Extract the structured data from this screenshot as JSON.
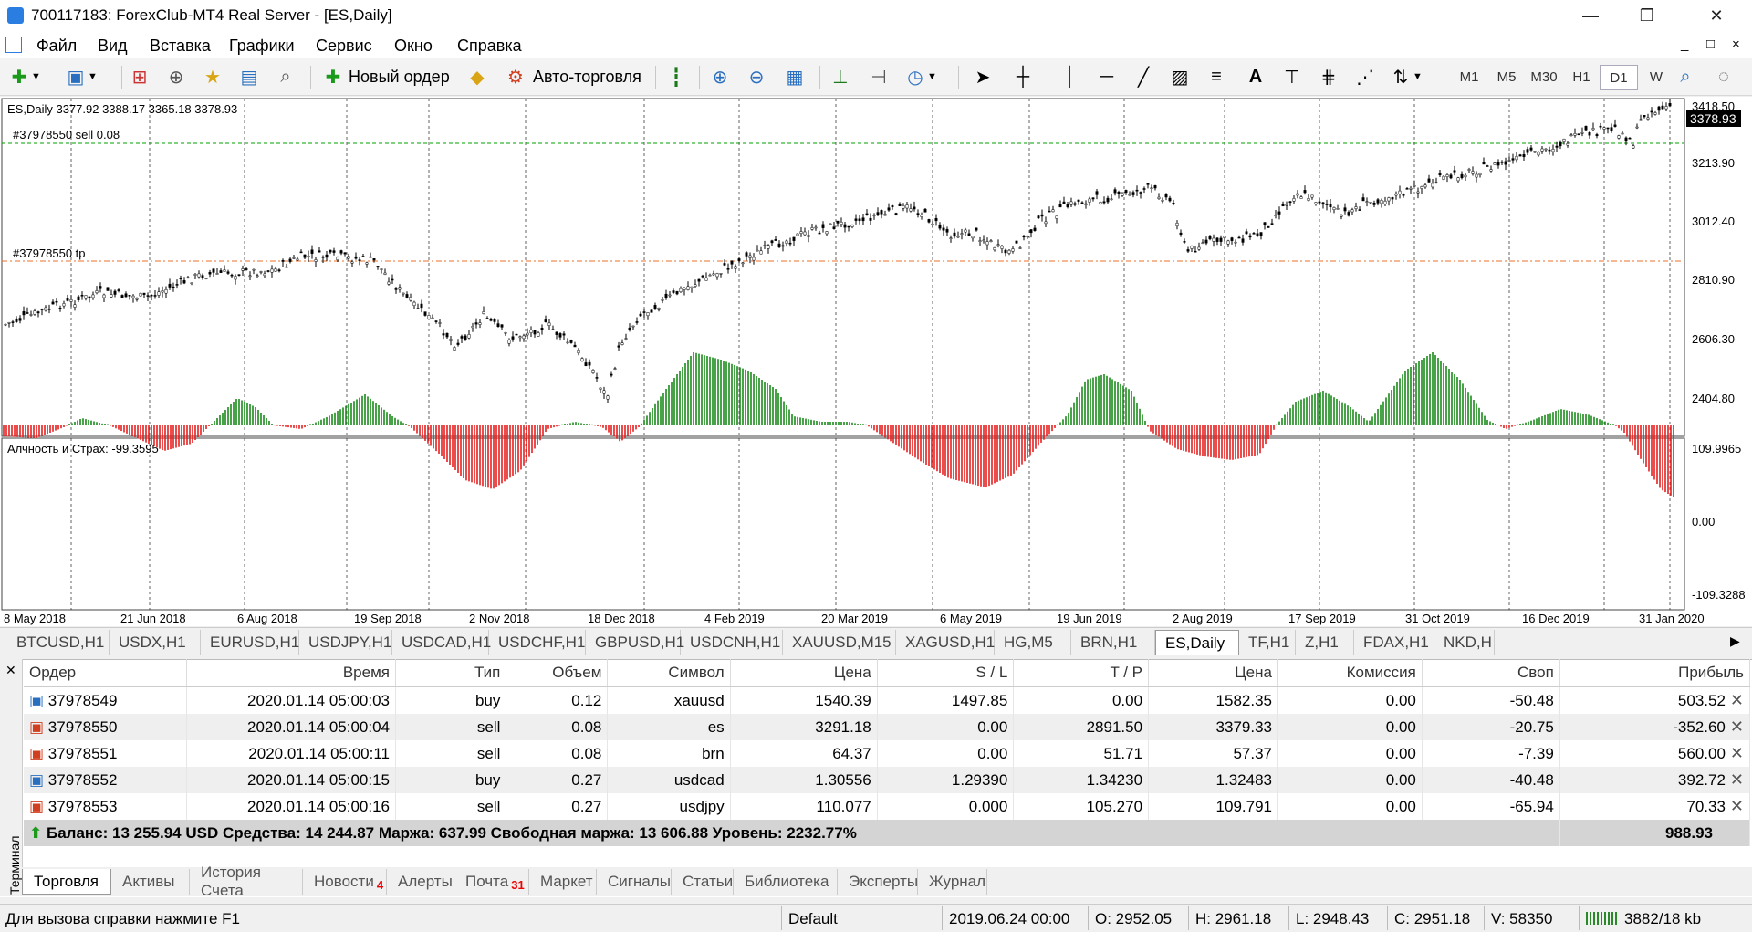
{
  "window": {
    "title": "700117183: ForexClub-MT4 Real Server - [ES,Daily]",
    "controls": [
      "—",
      "❐",
      "✕"
    ],
    "child_controls": [
      "_",
      "□",
      "×"
    ]
  },
  "menu": [
    "Файл",
    "Вид",
    "Вставка",
    "Графики",
    "Сервис",
    "Окно",
    "Справка"
  ],
  "toolbar": {
    "new_order": "Новый ордер",
    "auto_trading": "Авто-торговля",
    "timeframes": [
      "M1",
      "M5",
      "M30",
      "H1",
      "D1",
      "W"
    ],
    "active_timeframe": "D1"
  },
  "chart": {
    "header": "ES,Daily  3377.92 3388.17 3365.18 3378.93",
    "current_price": "3378.93",
    "order_line_1": "#37978550 sell 0.08",
    "order_line_2": "#37978550 tp",
    "price_axis": [
      "3418.50",
      "3213.90",
      "3012.40",
      "2810.90",
      "2606.30",
      "2404.80"
    ],
    "indicator_label": "Алчность и Страх: -99.3595",
    "indicator_axis": [
      "109.9965",
      "0.00",
      "-109.3288"
    ],
    "date_axis": [
      "8 May 2018",
      "21 Jun 2018",
      "6 Aug 2018",
      "19 Sep 2018",
      "2 Nov 2018",
      "18 Dec 2018",
      "4 Feb 2019",
      "20 Mar 2019",
      "6 May 2019",
      "19 Jun 2019",
      "2 Aug 2019",
      "17 Sep 2019",
      "31 Oct 2019",
      "16 Dec 2019",
      "31 Jan 2020"
    ],
    "colors": {
      "bull": "#1a8c1a",
      "bear": "#e62020",
      "sell_line": "#00a000",
      "tp_line": "#e8702a"
    }
  },
  "symbol_tabs": [
    "BTCUSD,H1",
    "USDX,H1",
    "EURUSD,H1",
    "USDJPY,H1",
    "USDCAD,H1",
    "USDCHF,H1",
    "GBPUSD,H1",
    "USDCNH,H1",
    "XAUUSD,M15",
    "XAGUSD,H1",
    "HG,M5",
    "BRN,H1",
    "ES,Daily",
    "TF,H1",
    "Z,H1",
    "FDAX,H1",
    "NKD,H"
  ],
  "active_symbol_tab": "ES,Daily",
  "terminal": {
    "side_label": "Терминал",
    "columns": [
      "Ордер",
      "Время",
      "Тип",
      "Объем",
      "Символ",
      "Цена",
      "S / L",
      "T / P",
      "Цена",
      "Комиссия",
      "Своп",
      "Прибыль"
    ],
    "rows": [
      [
        "37978549",
        "2020.01.14 05:00:03",
        "buy",
        "0.12",
        "xauusd",
        "1540.39",
        "1497.85",
        "0.00",
        "1582.35",
        "0.00",
        "-50.48",
        "503.52"
      ],
      [
        "37978550",
        "2020.01.14 05:00:04",
        "sell",
        "0.08",
        "es",
        "3291.18",
        "0.00",
        "2891.50",
        "3379.33",
        "0.00",
        "-20.75",
        "-352.60"
      ],
      [
        "37978551",
        "2020.01.14 05:00:11",
        "sell",
        "0.08",
        "brn",
        "64.37",
        "0.00",
        "51.71",
        "57.37",
        "0.00",
        "-7.39",
        "560.00"
      ],
      [
        "37978552",
        "2020.01.14 05:00:15",
        "buy",
        "0.27",
        "usdcad",
        "1.30556",
        "1.29390",
        "1.34230",
        "1.32483",
        "0.00",
        "-40.48",
        "392.72"
      ],
      [
        "37978553",
        "2020.01.14 05:00:16",
        "sell",
        "0.27",
        "usdjpy",
        "110.077",
        "0.000",
        "105.270",
        "109.791",
        "0.00",
        "-65.94",
        "70.33"
      ]
    ],
    "balance_line": "Баланс: 13 255.94 USD  Средства: 14 244.87  Маржа: 637.99  Свободная маржа: 13 606.88  Уровень: 2232.77%",
    "total_profit": "988.93",
    "tabs": [
      "Торговля",
      "Активы",
      "История Счета",
      "Новости",
      "Алерты",
      "Почта",
      "Маркет",
      "Сигналы",
      "Статьи",
      "Библиотека",
      "Эксперты",
      "Журнал"
    ],
    "news_badge": "4",
    "mail_badge": "31"
  },
  "status": {
    "help": "Для вызова справки нажмите F1",
    "profile": "Default",
    "datetime": "2019.06.24 00:00",
    "open": "O: 2952.05",
    "high": "H: 2961.18",
    "low": "L: 2948.43",
    "close": "C: 2951.18",
    "volume": "V: 58350",
    "traffic": "3882/18 kb"
  }
}
